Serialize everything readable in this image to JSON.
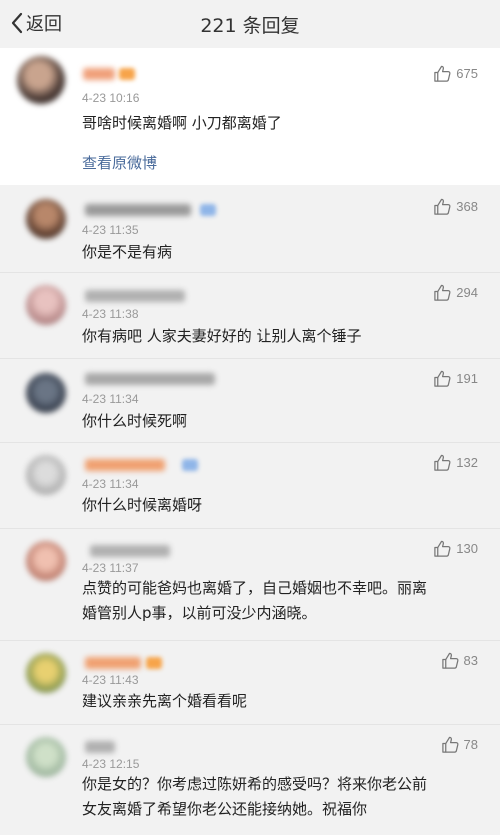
{
  "nav": {
    "back_label": "返回",
    "title": "221 条回复"
  },
  "main_comment": {
    "time": "4-23 10:16",
    "content": "哥啥时候离婚啊 小刀都离婚了",
    "likes": "675",
    "view_original": "查看原微博"
  },
  "replies": [
    {
      "time": "4-23 11:35",
      "content": "你是不是有病",
      "likes": "368"
    },
    {
      "time": "4-23 11:38",
      "content": "你有病吧   人家夫妻好好的  让别人离个锤子",
      "likes": "294"
    },
    {
      "time": "4-23 11:34",
      "content": "你什么时候死啊",
      "likes": "191"
    },
    {
      "time": "4-23 11:34",
      "content": "你什么时候离婚呀",
      "likes": "132"
    },
    {
      "time": "4-23 11:37",
      "content_line1": "点赞的可能爸妈也离婚了，自己婚姻也不幸吧。丽离",
      "content_line2": "婚管别人p事，以前可没少内涵晓。",
      "likes": "130"
    },
    {
      "time": "4-23 11:43",
      "content": "建议亲亲先离个婚看看呢",
      "likes": "83"
    },
    {
      "time": "4-23 12:15",
      "content_line1": "你是女的？你考虑过陈妍希的感受吗？将来你老公前",
      "content_line2": "女友离婚了希望你老公还能接纳她。祝福你",
      "likes": "78"
    }
  ],
  "colors": {
    "background": "#f2f2f2",
    "card": "#ffffff",
    "link": "#4a6b9b",
    "meta": "#999999"
  },
  "icons": {
    "back": "chevron-left-icon",
    "like": "thumbs-up-icon"
  }
}
